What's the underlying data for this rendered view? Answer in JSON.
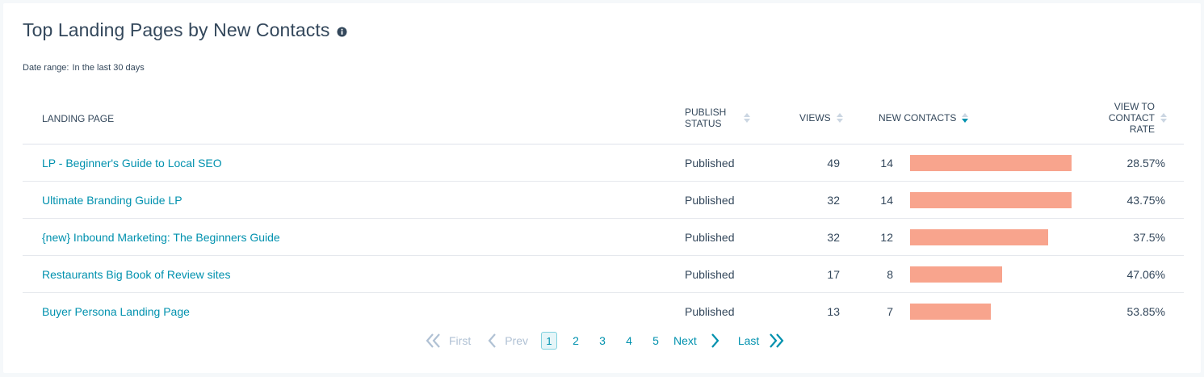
{
  "report": {
    "title": "Top Landing Pages by New Contacts",
    "date_range_label": "Date range:",
    "date_range_value": "In the last 30 days"
  },
  "table": {
    "headers": {
      "landing_page": "LANDING PAGE",
      "publish_status": "PUBLISH\nSTATUS",
      "views": "VIEWS",
      "new_contacts": "NEW CONTACTS",
      "view_to_contact_rate": "VIEW TO\nCONTACT\nRATE"
    },
    "sorted_by": "new_contacts",
    "max_new_contacts": 14,
    "rows": [
      {
        "landing_page": "LP - Beginner's Guide to Local SEO",
        "publish_status": "Published",
        "views": "49",
        "new_contacts": "14",
        "new_contacts_value": 14,
        "rate": "28.57%"
      },
      {
        "landing_page": "Ultimate Branding Guide LP",
        "publish_status": "Published",
        "views": "32",
        "new_contacts": "14",
        "new_contacts_value": 14,
        "rate": "43.75%"
      },
      {
        "landing_page": "{new} Inbound Marketing: The Beginners Guide",
        "publish_status": "Published",
        "views": "32",
        "new_contacts": "12",
        "new_contacts_value": 12,
        "rate": "37.5%"
      },
      {
        "landing_page": "Restaurants Big Book of Review sites",
        "publish_status": "Published",
        "views": "17",
        "new_contacts": "8",
        "new_contacts_value": 8,
        "rate": "47.06%"
      },
      {
        "landing_page": "Buyer Persona Landing Page",
        "publish_status": "Published",
        "views": "13",
        "new_contacts": "7",
        "new_contacts_value": 7,
        "rate": "53.85%"
      }
    ]
  },
  "pagination": {
    "first_label": "First",
    "prev_label": "Prev",
    "pages": [
      "1",
      "2",
      "3",
      "4",
      "5"
    ],
    "current_page": "1",
    "next_label": "Next",
    "last_label": "Last"
  },
  "colors": {
    "link": "#0091ae",
    "bar": "#f8a48d",
    "text": "#33475b",
    "disabled": "#b0c1d4"
  },
  "icons": {
    "info": "info-icon",
    "sort": "sort-icon",
    "first": "double-chevron-left-icon",
    "prev": "chevron-left-icon",
    "next": "chevron-right-icon",
    "last": "double-chevron-right-icon"
  }
}
